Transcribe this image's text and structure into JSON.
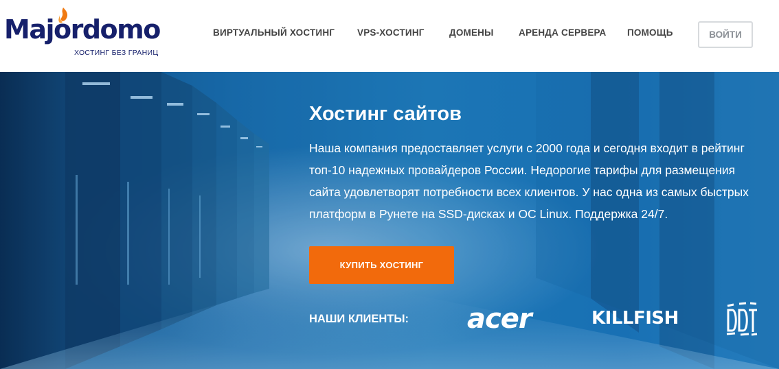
{
  "header": {
    "logo": {
      "name": "Majordomo",
      "tagline": "ХОСТИНГ БЕЗ ГРАНИЦ",
      "flame_icon": "flame-icon",
      "brand_color": "#16206b",
      "flame_color": "#f07a12"
    },
    "nav": [
      {
        "label": "ВИРТУАЛЬНЫЙ ХОСТИНГ"
      },
      {
        "label": "VPS-ХОСТИНГ"
      },
      {
        "label": "ДОМЕНЫ"
      },
      {
        "label": "АРЕНДА СЕРВЕРА"
      },
      {
        "label": "ПОМОЩЬ"
      }
    ],
    "login_label": "ВОЙТИ"
  },
  "hero": {
    "title": "Хостинг сайтов",
    "description": "Наша компания предоставляет услуги с 2000 года и сегодня входит в рейтинг топ-10 надежных провайдеров России. Недорогие тарифы для размещения сайта удовлетворят потребности всех клиентов. У нас одна из самых быстрых платформ в Рунете на SSD-дисках и ОС Linux. Поддержка 24/7.",
    "cta_label": "КУПИТЬ ХОСТИНГ",
    "cta_color": "#f26a0c",
    "clients_label": "НАШИ КЛИЕНТЫ:",
    "clients": [
      {
        "name": "acer"
      },
      {
        "name": "KILLFISH"
      },
      {
        "name": "DDT"
      }
    ]
  }
}
